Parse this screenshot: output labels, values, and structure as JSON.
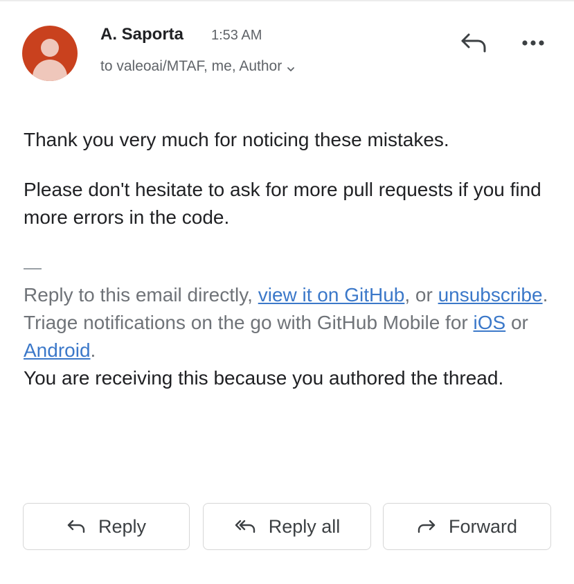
{
  "message": {
    "sender": "A. Saporta",
    "time": "1:53 AM",
    "recipients": "to valeoai/MTAF, me, Author",
    "avatar_color": "#c9411e"
  },
  "icons": {
    "reply": "reply-arrow-icon",
    "more": "more-horizontal-icon",
    "chevron": "chevron-down-icon",
    "reply_all": "reply-all-icon",
    "forward": "forward-arrow-icon"
  },
  "body": {
    "paragraph_1": "Thank you very much for noticing these mistakes.",
    "paragraph_2": "Please don't hesitate to ask for more pull requests if you find more errors in the code."
  },
  "footer": {
    "dash": "—",
    "line1_prefix": "Reply to this email directly, ",
    "link_github": "view it on GitHub",
    "line1_mid": ", or ",
    "link_unsubscribe": "unsubscribe",
    "line1_end": ".",
    "line2_prefix": "Triage notifications on the go with GitHub Mobile for ",
    "link_ios": "iOS",
    "line2_mid": " or ",
    "link_android": "Android",
    "line2_end": ".",
    "line3": "You are receiving this because you authored the thread."
  },
  "actions": {
    "reply": "Reply",
    "reply_all": "Reply all",
    "forward": "Forward"
  },
  "colors": {
    "link": "#3b78c9",
    "muted": "#6f7378",
    "text": "#202124"
  }
}
